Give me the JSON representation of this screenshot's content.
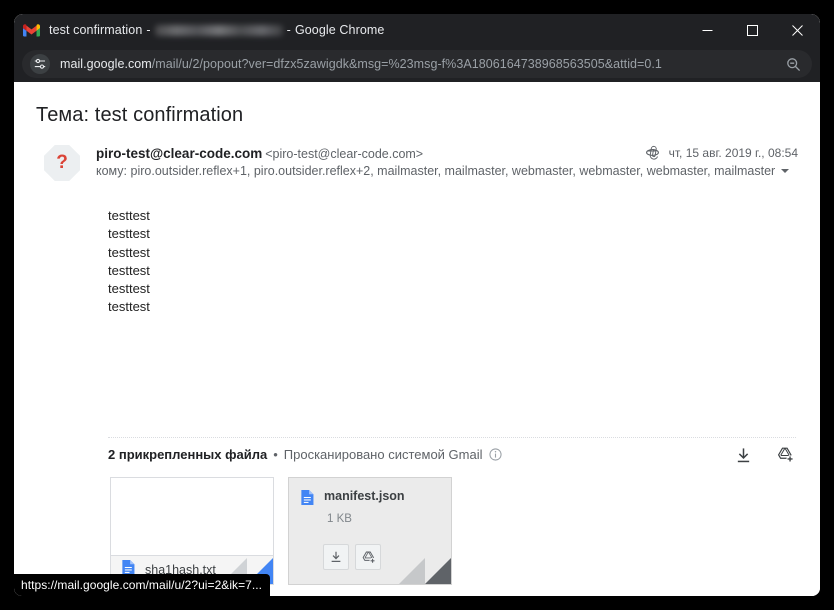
{
  "window": {
    "title_app": "test confirmation",
    "title_sep": "-",
    "title_browser": "Google Chrome",
    "minimize_label": "minimize",
    "maximize_label": "maximize",
    "close_label": "close"
  },
  "omnibox": {
    "url_host": "mail.google.com",
    "url_path": "/mail/u/2/popout?ver=dfzx5zawigdk&msg=%23msg-f%3A1806164738968563505&attid=0.1",
    "site_info_icon": "tune-icon",
    "zoom_icon": "zoom-out-icon"
  },
  "message": {
    "subject": "Тема: test confirmation",
    "avatar_glyph": "?",
    "from_name": "piro-test@clear-code.com",
    "from_address": "<piro-test@clear-code.com>",
    "to_label": "кому:",
    "to_recipients": "piro.outsider.reflex+1, piro.outsider.reflex+2, mailmaster, mailmaster, webmaster, webmaster, webmaster, mailmaster",
    "date": "чт, 15 авг. 2019 г., 08:54",
    "body_lines": [
      "testtest",
      "testtest",
      "testtest",
      "testtest",
      "testtest",
      "testtest"
    ]
  },
  "attachments": {
    "count_label": "2 прикрепленных файла",
    "separator": "•",
    "scanned_label": "Просканировано системой Gmail",
    "download_all_label": "Скачать все",
    "save_all_drive_label": "Сохранить все на Диске",
    "items": [
      {
        "name": "sha1hash.txt",
        "size": "",
        "state": "normal",
        "icon": "text-file-icon"
      },
      {
        "name": "manifest.json",
        "size": "1 KB",
        "state": "hover",
        "icon": "text-file-icon",
        "download_label": "Скачать",
        "drive_label": "Сохранить на Диске"
      }
    ]
  },
  "status_bar": {
    "url": "https://mail.google.com/mail/u/2?ui=2&ik=7..."
  },
  "colors": {
    "chrome_dark": "#202124",
    "omnibox_bg": "#292a2d",
    "accent_blue": "#4285f4",
    "avatar_red": "#db4437",
    "text_secondary": "#5f6368"
  }
}
